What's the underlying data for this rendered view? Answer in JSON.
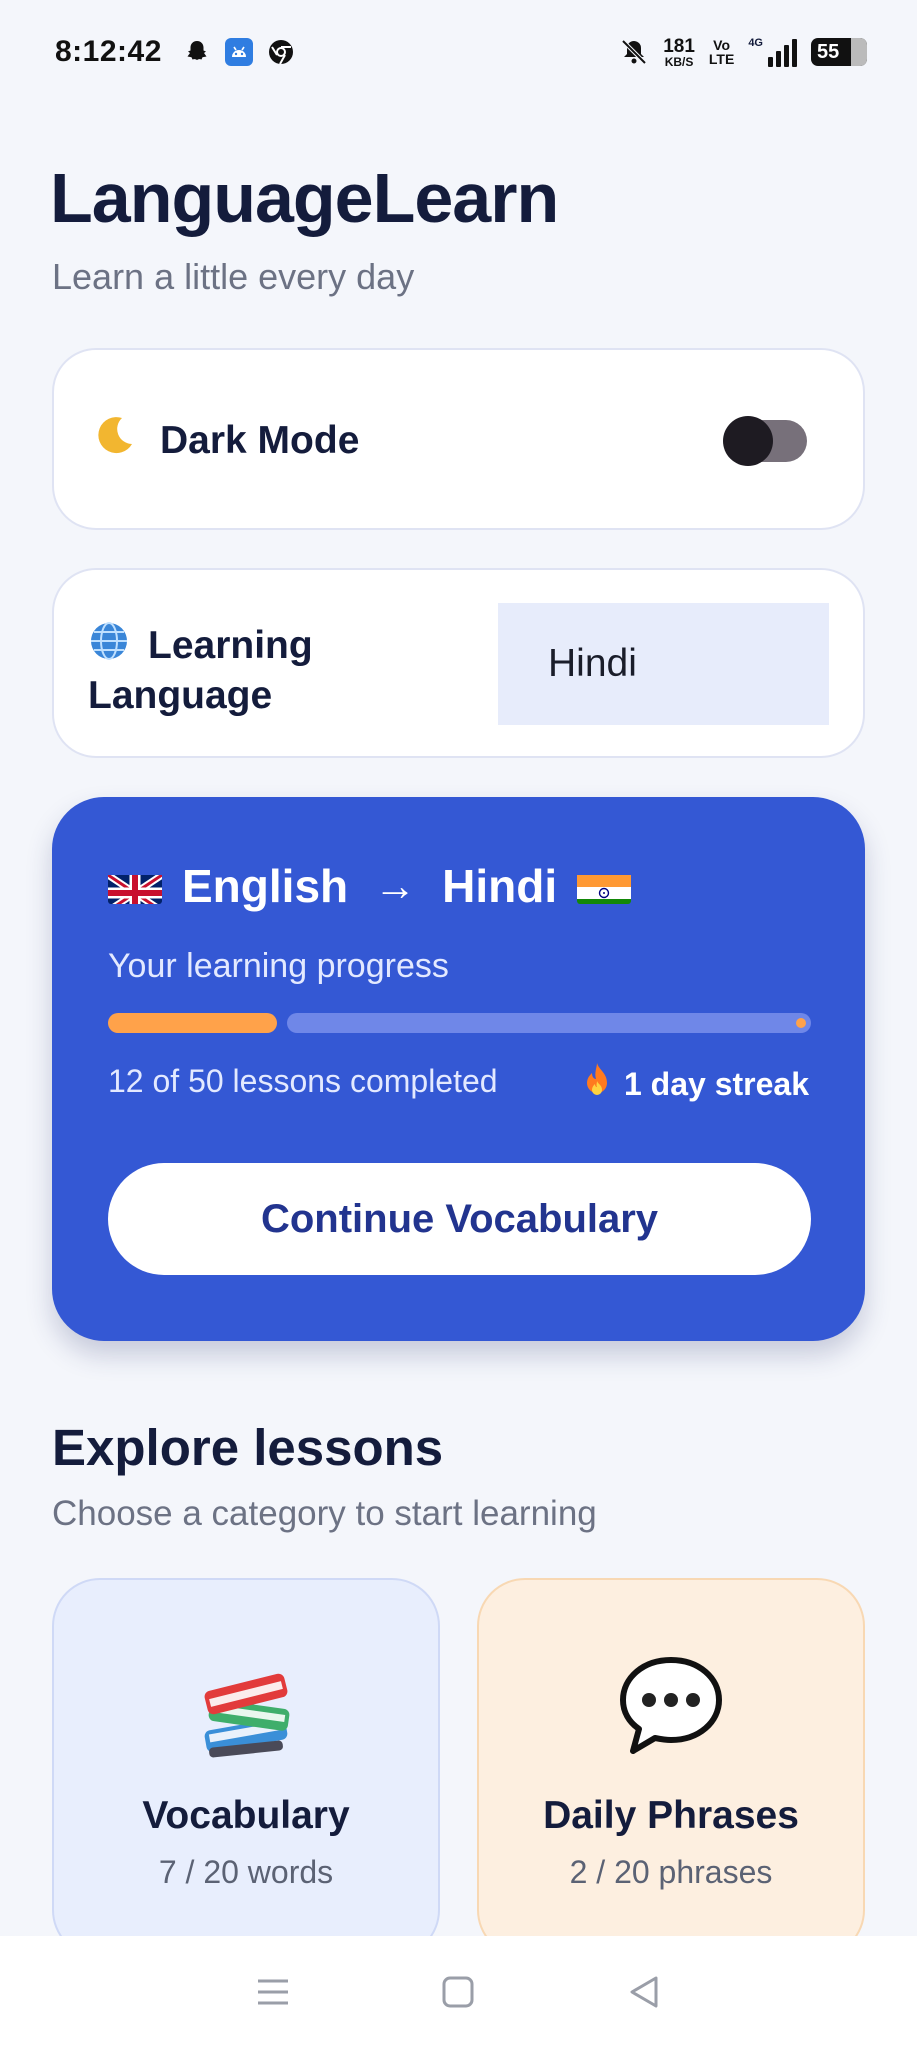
{
  "status_bar": {
    "time": "8:12:42",
    "net_speed_value": "181",
    "net_speed_unit": "KB/S",
    "volte_top": "Vo",
    "volte_bottom": "LTE",
    "network_type": "4G",
    "battery_level": "55",
    "icons": [
      "snapchat-icon",
      "android-icon",
      "chrome-icon",
      "bell-muted-icon",
      "signal-icon",
      "battery-icon"
    ]
  },
  "header": {
    "title": "LanguageLearn",
    "subtitle": "Learn a little every day"
  },
  "dark_mode": {
    "icon": "moon-icon",
    "label": "Dark Mode",
    "enabled": false
  },
  "learning_language": {
    "icon": "globe-icon",
    "label_line1": "Learning",
    "label_line2": "Language",
    "selected": "Hindi"
  },
  "progress_card": {
    "from_flag": "uk-flag-icon",
    "from_language": "English",
    "arrow": "→",
    "to_language": "Hindi",
    "to_flag": "india-flag-icon",
    "caption": "Your learning progress",
    "progress_fraction": 0.24,
    "lessons_text": "12 of 50 lessons completed",
    "streak_icon": "fire-icon",
    "streak_text": "1 day streak",
    "cta_label": "Continue Vocabulary",
    "colors": {
      "card": "#3458d4",
      "fill": "#ffa24a",
      "track": "#6f87e8"
    }
  },
  "explore": {
    "title": "Explore lessons",
    "subtitle": "Choose a category to start learning",
    "categories": [
      {
        "icon": "books-icon",
        "title": "Vocabulary",
        "count": "7 / 20 words"
      },
      {
        "icon": "speech-bubble-icon",
        "title": "Daily Phrases",
        "count": "2 / 20 phrases"
      }
    ]
  },
  "nav_bar": {
    "buttons": [
      "menu-icon",
      "home-square-icon",
      "back-triangle-icon"
    ]
  }
}
